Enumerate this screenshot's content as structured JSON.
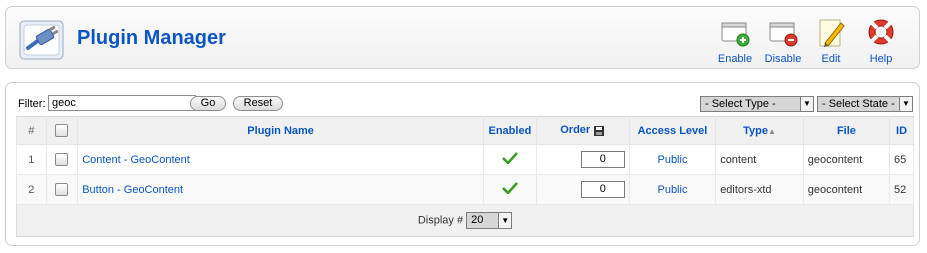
{
  "header": {
    "title": "Plugin Manager",
    "logo_icon": "plugin-cable-icon"
  },
  "toolbar": {
    "enable_label": "Enable",
    "disable_label": "Disable",
    "edit_label": "Edit",
    "help_label": "Help"
  },
  "filter": {
    "label": "Filter:",
    "value": "geoc",
    "go_label": "Go",
    "reset_label": "Reset",
    "type_select": "- Select Type -",
    "state_select": "- Select State -"
  },
  "table": {
    "columns": {
      "num": "#",
      "name": "Plugin Name",
      "enabled": "Enabled",
      "order": "Order",
      "access": "Access Level",
      "type": "Type",
      "file": "File",
      "id": "ID"
    },
    "rows": [
      {
        "num": "1",
        "name": "Content - GeoContent",
        "enabled": true,
        "order": "0",
        "access": "Public",
        "type": "content",
        "file": "geocontent",
        "id": "65"
      },
      {
        "num": "2",
        "name": "Button - GeoContent",
        "enabled": true,
        "order": "0",
        "access": "Public",
        "type": "editors-xtd",
        "file": "geocontent",
        "id": "52"
      }
    ]
  },
  "footer": {
    "display_label": "Display #",
    "display_value": "20"
  },
  "colors": {
    "link": "#0b55c4",
    "public": "#008000",
    "header_bg": "#f0f0f0"
  }
}
